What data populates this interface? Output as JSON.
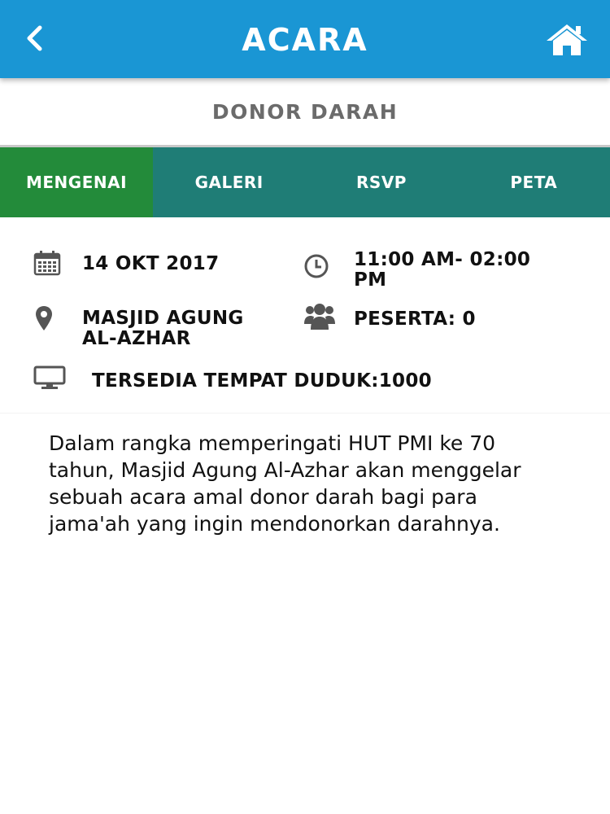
{
  "header": {
    "title": "ACARA",
    "back_icon": "chevron-left-icon",
    "home_icon": "home-icon",
    "background": "#1a96d4"
  },
  "event": {
    "name": "DONOR DARAH"
  },
  "tabs": [
    {
      "label": "MENGENAI",
      "active": true
    },
    {
      "label": "GALERI",
      "active": false
    },
    {
      "label": "RSVP",
      "active": false
    },
    {
      "label": "PETA",
      "active": false
    }
  ],
  "colors": {
    "tab_active": "#238b3a",
    "tab_bar": "#1f7d76"
  },
  "details": {
    "date": {
      "icon": "calendar-icon",
      "text": "14 OKT 2017"
    },
    "time": {
      "icon": "clock-icon",
      "line1": "11:00 AM- 02:00",
      "line2": "PM"
    },
    "location": {
      "icon": "map-pin-icon",
      "line1": "MASJID AGUNG",
      "line2": "AL-AZHAR"
    },
    "participants": {
      "icon": "users-icon",
      "text": "PESERTA: 0"
    },
    "seats": {
      "icon": "monitor-icon",
      "text": "TERSEDIA TEMPAT DUDUK:1000"
    }
  },
  "description": "Dalam rangka memperingati HUT PMI ke 70 tahun, Masjid Agung Al-Azhar akan menggelar sebuah acara amal donor darah bagi para jama'ah yang ingin mendonorkan darahnya."
}
